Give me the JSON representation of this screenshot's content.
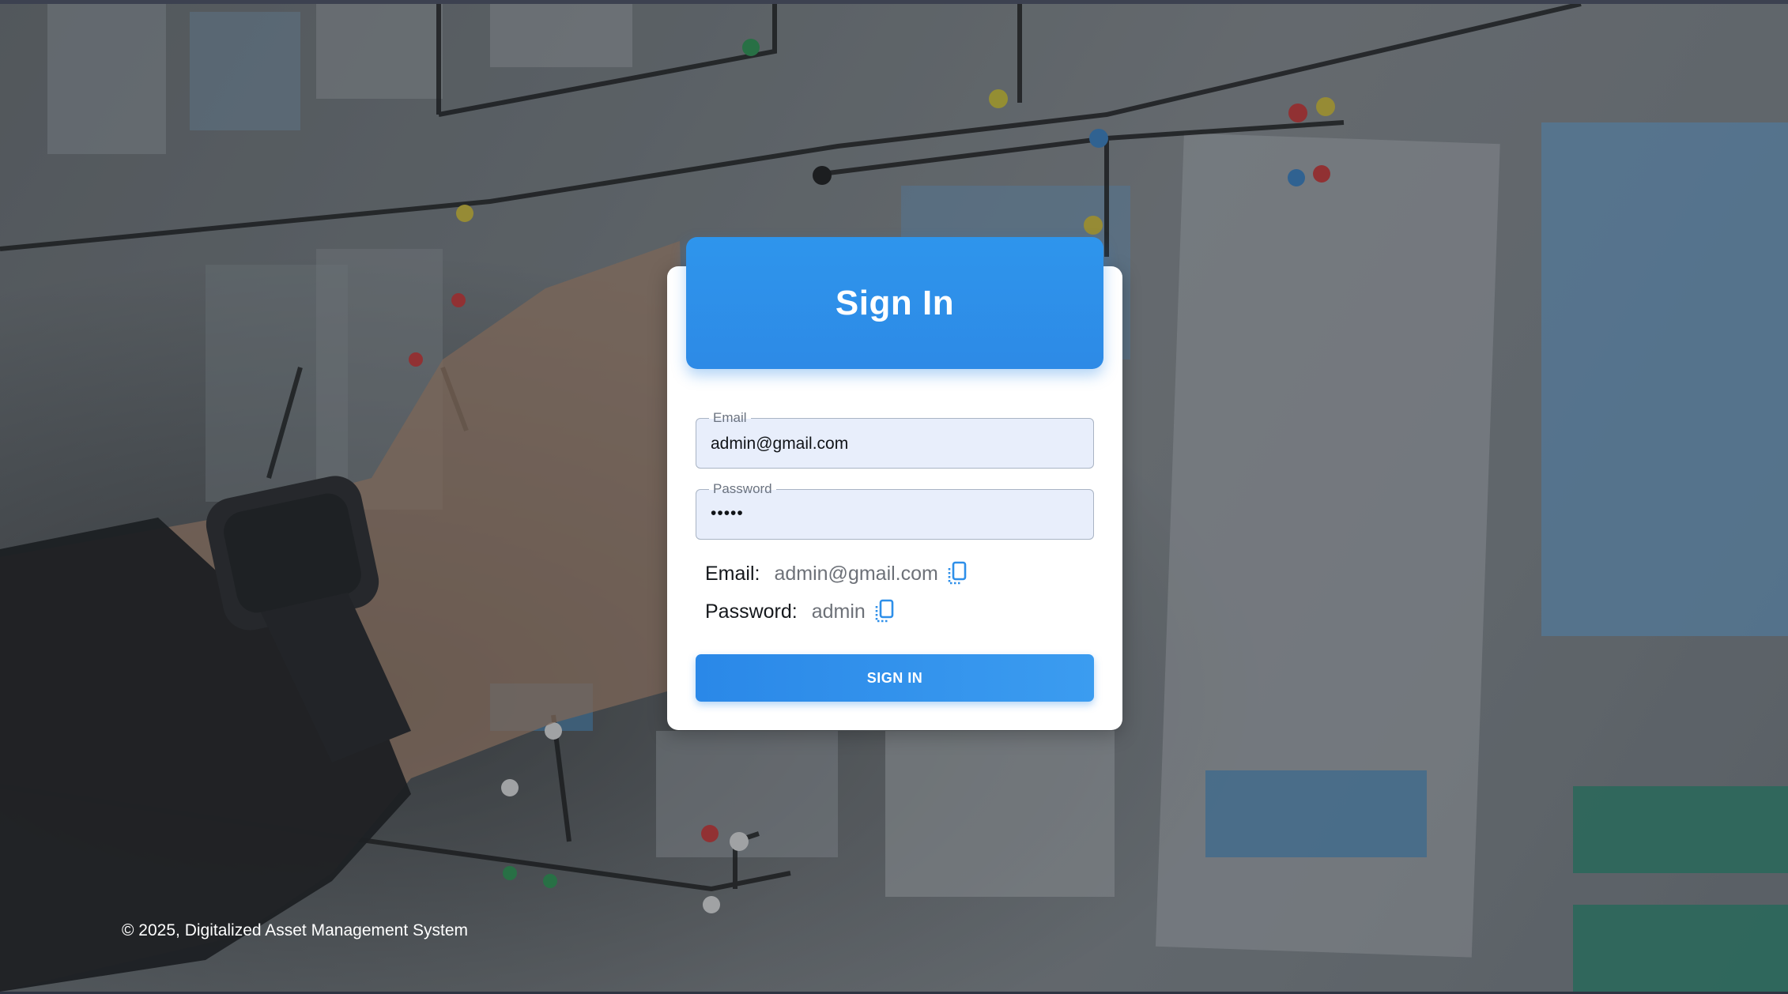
{
  "header": {
    "title": "Sign In"
  },
  "form": {
    "email": {
      "label": "Email",
      "value": "admin@gmail.com"
    },
    "password": {
      "label": "Password",
      "value": "•••••"
    }
  },
  "credentials": {
    "email_label": "Email:",
    "email_value": "admin@gmail.com",
    "password_label": "Password:",
    "password_value": "admin",
    "copy_icon": "copy-icon"
  },
  "actions": {
    "signin_label": "SIGN IN"
  },
  "footer": {
    "text": "© 2025, Digitalized Asset Management System"
  },
  "colors": {
    "accent": "#2e8fe9",
    "field_bg": "#e8eefb",
    "card_bg": "#ffffff"
  }
}
